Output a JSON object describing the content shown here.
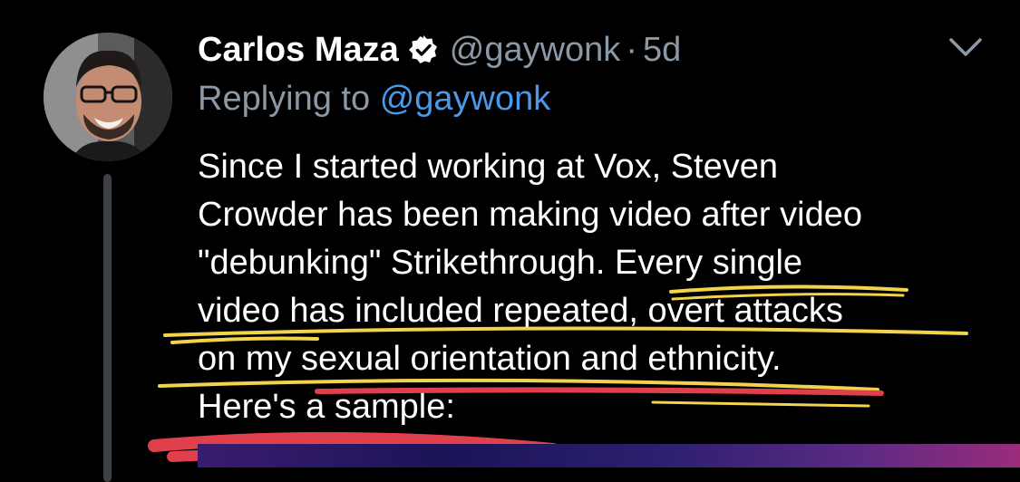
{
  "tweet": {
    "display_name": "Carlos Maza",
    "handle": "@gaywonk",
    "separator": "·",
    "time": "5d",
    "replying_prefix": "Replying to",
    "replying_handle": "@gaywonk",
    "text_lines": [
      "Since I started working at Vox, Steven",
      "Crowder has been making video after video",
      "\"debunking\" Strikethrough. Every single",
      "video has included repeated, overt attacks",
      "on my sexual orientation and ethnicity.",
      "Here's a sample:"
    ]
  },
  "icons": {
    "verified": "verified-badge-icon",
    "menu": "chevron-down-icon"
  },
  "colors": {
    "background": "#000000",
    "text": "#ffffff",
    "secondary_text": "#8b98a5",
    "link": "#4a99e9",
    "highlight_yellow": "#f2d34c",
    "highlight_red": "#e0404c",
    "thread_line": "#3e4144"
  }
}
